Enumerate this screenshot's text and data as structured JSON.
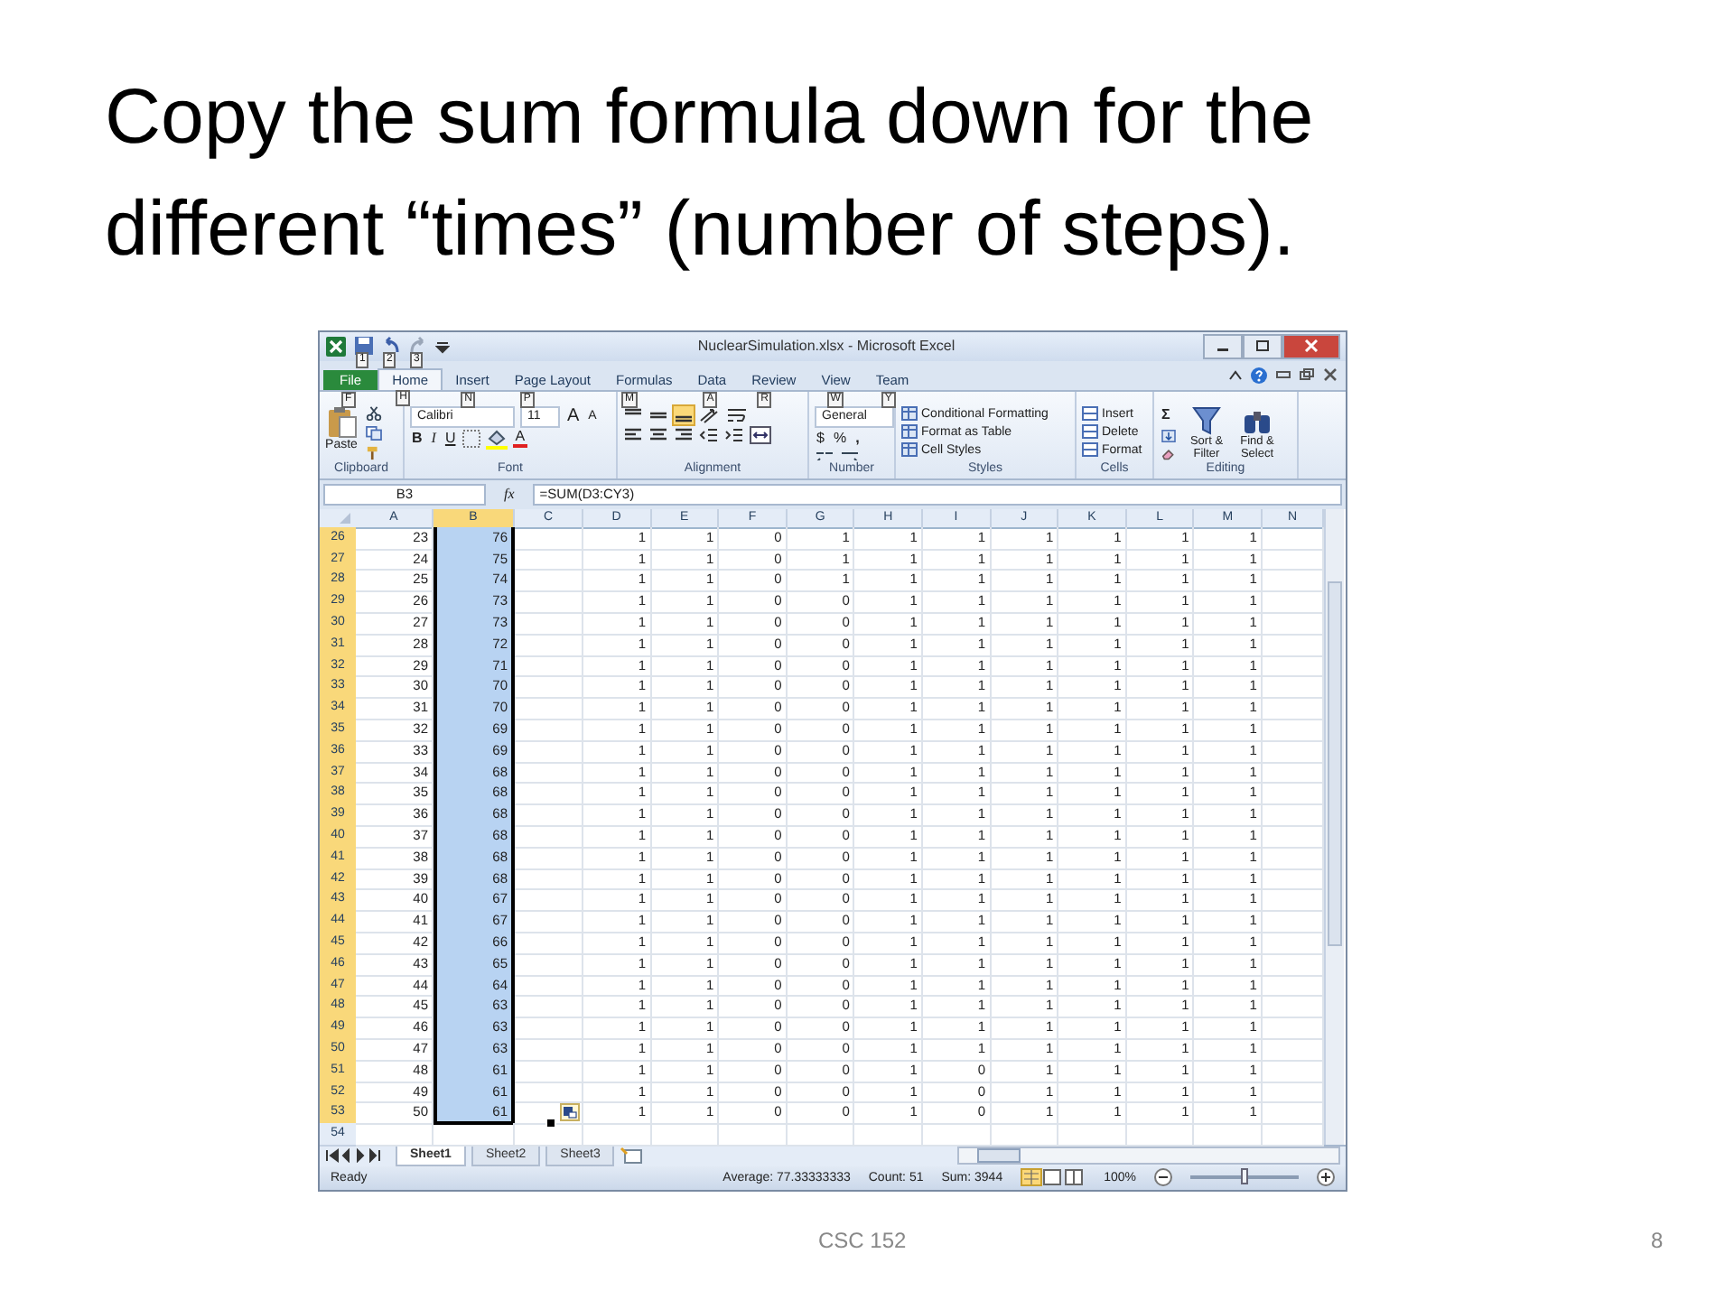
{
  "slide": {
    "title": "Copy the sum formula down for the different “times” (number of steps).",
    "footer": "CSC 152",
    "page_number": "8"
  },
  "window": {
    "title": "NuclearSimulation.xlsx - Microsoft Excel",
    "quick_access_keytips": [
      "1",
      "2",
      "3"
    ]
  },
  "ribbon_tabs": [
    {
      "label": "File",
      "keytip": "F",
      "kind": "file",
      "selected": false
    },
    {
      "label": "Home",
      "keytip": "H",
      "kind": "tab",
      "selected": true
    },
    {
      "label": "Insert",
      "keytip": "N",
      "kind": "tab",
      "selected": false
    },
    {
      "label": "Page Layout",
      "keytip": "P",
      "kind": "tab",
      "selected": false
    },
    {
      "label": "Formulas",
      "keytip": "M",
      "kind": "tab",
      "selected": false
    },
    {
      "label": "Data",
      "keytip": "A",
      "kind": "tab",
      "selected": false
    },
    {
      "label": "Review",
      "keytip": "R",
      "kind": "tab",
      "selected": false
    },
    {
      "label": "View",
      "keytip": "W",
      "kind": "tab",
      "selected": false
    },
    {
      "label": "Team",
      "keytip": "Y",
      "kind": "tab",
      "selected": false
    }
  ],
  "ribbon": {
    "clipboard": {
      "paste": "Paste",
      "label": "Clipboard"
    },
    "font": {
      "name": "Calibri",
      "size": "11",
      "grow": "A",
      "shrink": "A",
      "bold": "B",
      "italic": "I",
      "underline": "U",
      "font_color_letter": "A",
      "label": "Font"
    },
    "alignment": {
      "label": "Alignment"
    },
    "number": {
      "format": "General",
      "currency": "$",
      "percent": "%",
      "comma": ",",
      "label": "Number"
    },
    "styles": {
      "items": [
        "Conditional Formatting",
        "Format as Table",
        "Cell Styles"
      ],
      "label": "Styles"
    },
    "cells": {
      "items": [
        "Insert",
        "Delete",
        "Format"
      ],
      "label": "Cells"
    },
    "editing": {
      "sum": "Σ",
      "sort": "Sort & Filter",
      "find": "Find & Select",
      "label": "Editing"
    }
  },
  "formula_bar": {
    "name_box": "B3",
    "fx": "fx",
    "formula": "=SUM(D3:CY3)"
  },
  "sheet": {
    "columns": [
      {
        "label": "A",
        "selected": false
      },
      {
        "label": "B",
        "selected": true
      },
      {
        "label": "C",
        "selected": false
      },
      {
        "label": "D",
        "selected": false
      },
      {
        "label": "E",
        "selected": false
      },
      {
        "label": "F",
        "selected": false
      },
      {
        "label": "G",
        "selected": false
      },
      {
        "label": "H",
        "selected": false
      },
      {
        "label": "I",
        "selected": false
      },
      {
        "label": "J",
        "selected": false
      },
      {
        "label": "K",
        "selected": false
      },
      {
        "label": "L",
        "selected": false
      },
      {
        "label": "M",
        "selected": false
      },
      {
        "label": "N",
        "selected": false
      }
    ],
    "rows": [
      {
        "header": "26",
        "selected": true,
        "a": "23",
        "b": "76",
        "values": [
          "1",
          "1",
          "0",
          "1",
          "1",
          "1",
          "1",
          "1",
          "1",
          "1"
        ]
      },
      {
        "header": "27",
        "selected": true,
        "a": "24",
        "b": "75",
        "values": [
          "1",
          "1",
          "0",
          "1",
          "1",
          "1",
          "1",
          "1",
          "1",
          "1"
        ]
      },
      {
        "header": "28",
        "selected": true,
        "a": "25",
        "b": "74",
        "values": [
          "1",
          "1",
          "0",
          "1",
          "1",
          "1",
          "1",
          "1",
          "1",
          "1"
        ]
      },
      {
        "header": "29",
        "selected": true,
        "a": "26",
        "b": "73",
        "values": [
          "1",
          "1",
          "0",
          "0",
          "1",
          "1",
          "1",
          "1",
          "1",
          "1"
        ]
      },
      {
        "header": "30",
        "selected": true,
        "a": "27",
        "b": "73",
        "values": [
          "1",
          "1",
          "0",
          "0",
          "1",
          "1",
          "1",
          "1",
          "1",
          "1"
        ]
      },
      {
        "header": "31",
        "selected": true,
        "a": "28",
        "b": "72",
        "values": [
          "1",
          "1",
          "0",
          "0",
          "1",
          "1",
          "1",
          "1",
          "1",
          "1"
        ]
      },
      {
        "header": "32",
        "selected": true,
        "a": "29",
        "b": "71",
        "values": [
          "1",
          "1",
          "0",
          "0",
          "1",
          "1",
          "1",
          "1",
          "1",
          "1"
        ]
      },
      {
        "header": "33",
        "selected": true,
        "a": "30",
        "b": "70",
        "values": [
          "1",
          "1",
          "0",
          "0",
          "1",
          "1",
          "1",
          "1",
          "1",
          "1"
        ]
      },
      {
        "header": "34",
        "selected": true,
        "a": "31",
        "b": "70",
        "values": [
          "1",
          "1",
          "0",
          "0",
          "1",
          "1",
          "1",
          "1",
          "1",
          "1"
        ]
      },
      {
        "header": "35",
        "selected": true,
        "a": "32",
        "b": "69",
        "values": [
          "1",
          "1",
          "0",
          "0",
          "1",
          "1",
          "1",
          "1",
          "1",
          "1"
        ]
      },
      {
        "header": "36",
        "selected": true,
        "a": "33",
        "b": "69",
        "values": [
          "1",
          "1",
          "0",
          "0",
          "1",
          "1",
          "1",
          "1",
          "1",
          "1"
        ]
      },
      {
        "header": "37",
        "selected": true,
        "a": "34",
        "b": "68",
        "values": [
          "1",
          "1",
          "0",
          "0",
          "1",
          "1",
          "1",
          "1",
          "1",
          "1"
        ]
      },
      {
        "header": "38",
        "selected": true,
        "a": "35",
        "b": "68",
        "values": [
          "1",
          "1",
          "0",
          "0",
          "1",
          "1",
          "1",
          "1",
          "1",
          "1"
        ]
      },
      {
        "header": "39",
        "selected": true,
        "a": "36",
        "b": "68",
        "values": [
          "1",
          "1",
          "0",
          "0",
          "1",
          "1",
          "1",
          "1",
          "1",
          "1"
        ]
      },
      {
        "header": "40",
        "selected": true,
        "a": "37",
        "b": "68",
        "values": [
          "1",
          "1",
          "0",
          "0",
          "1",
          "1",
          "1",
          "1",
          "1",
          "1"
        ]
      },
      {
        "header": "41",
        "selected": true,
        "a": "38",
        "b": "68",
        "values": [
          "1",
          "1",
          "0",
          "0",
          "1",
          "1",
          "1",
          "1",
          "1",
          "1"
        ]
      },
      {
        "header": "42",
        "selected": true,
        "a": "39",
        "b": "68",
        "values": [
          "1",
          "1",
          "0",
          "0",
          "1",
          "1",
          "1",
          "1",
          "1",
          "1"
        ]
      },
      {
        "header": "43",
        "selected": true,
        "a": "40",
        "b": "67",
        "values": [
          "1",
          "1",
          "0",
          "0",
          "1",
          "1",
          "1",
          "1",
          "1",
          "1"
        ]
      },
      {
        "header": "44",
        "selected": true,
        "a": "41",
        "b": "67",
        "values": [
          "1",
          "1",
          "0",
          "0",
          "1",
          "1",
          "1",
          "1",
          "1",
          "1"
        ]
      },
      {
        "header": "45",
        "selected": true,
        "a": "42",
        "b": "66",
        "values": [
          "1",
          "1",
          "0",
          "0",
          "1",
          "1",
          "1",
          "1",
          "1",
          "1"
        ]
      },
      {
        "header": "46",
        "selected": true,
        "a": "43",
        "b": "65",
        "values": [
          "1",
          "1",
          "0",
          "0",
          "1",
          "1",
          "1",
          "1",
          "1",
          "1"
        ]
      },
      {
        "header": "47",
        "selected": true,
        "a": "44",
        "b": "64",
        "values": [
          "1",
          "1",
          "0",
          "0",
          "1",
          "1",
          "1",
          "1",
          "1",
          "1"
        ]
      },
      {
        "header": "48",
        "selected": true,
        "a": "45",
        "b": "63",
        "values": [
          "1",
          "1",
          "0",
          "0",
          "1",
          "1",
          "1",
          "1",
          "1",
          "1"
        ]
      },
      {
        "header": "49",
        "selected": true,
        "a": "46",
        "b": "63",
        "values": [
          "1",
          "1",
          "0",
          "0",
          "1",
          "1",
          "1",
          "1",
          "1",
          "1"
        ]
      },
      {
        "header": "50",
        "selected": true,
        "a": "47",
        "b": "63",
        "values": [
          "1",
          "1",
          "0",
          "0",
          "1",
          "1",
          "1",
          "1",
          "1",
          "1"
        ]
      },
      {
        "header": "51",
        "selected": true,
        "a": "48",
        "b": "61",
        "values": [
          "1",
          "1",
          "0",
          "0",
          "1",
          "0",
          "1",
          "1",
          "1",
          "1"
        ]
      },
      {
        "header": "52",
        "selected": true,
        "a": "49",
        "b": "61",
        "values": [
          "1",
          "1",
          "0",
          "0",
          "1",
          "0",
          "1",
          "1",
          "1",
          "1"
        ]
      },
      {
        "header": "53",
        "selected": true,
        "a": "50",
        "b": "61",
        "values": [
          "1",
          "1",
          "0",
          "0",
          "1",
          "0",
          "1",
          "1",
          "1",
          "1"
        ]
      },
      {
        "header": "54",
        "selected": false
      }
    ]
  },
  "sheet_tabs": [
    {
      "label": "Sheet1",
      "selected": true
    },
    {
      "label": "Sheet2",
      "selected": false
    },
    {
      "label": "Sheet3",
      "selected": false
    }
  ],
  "status_bar": {
    "mode": "Ready",
    "average": "Average: 77.33333333",
    "count": "Count: 51",
    "sum": "Sum: 3944",
    "zoom": "100%",
    "zoom_level": {
      "level": 0.5
    }
  }
}
